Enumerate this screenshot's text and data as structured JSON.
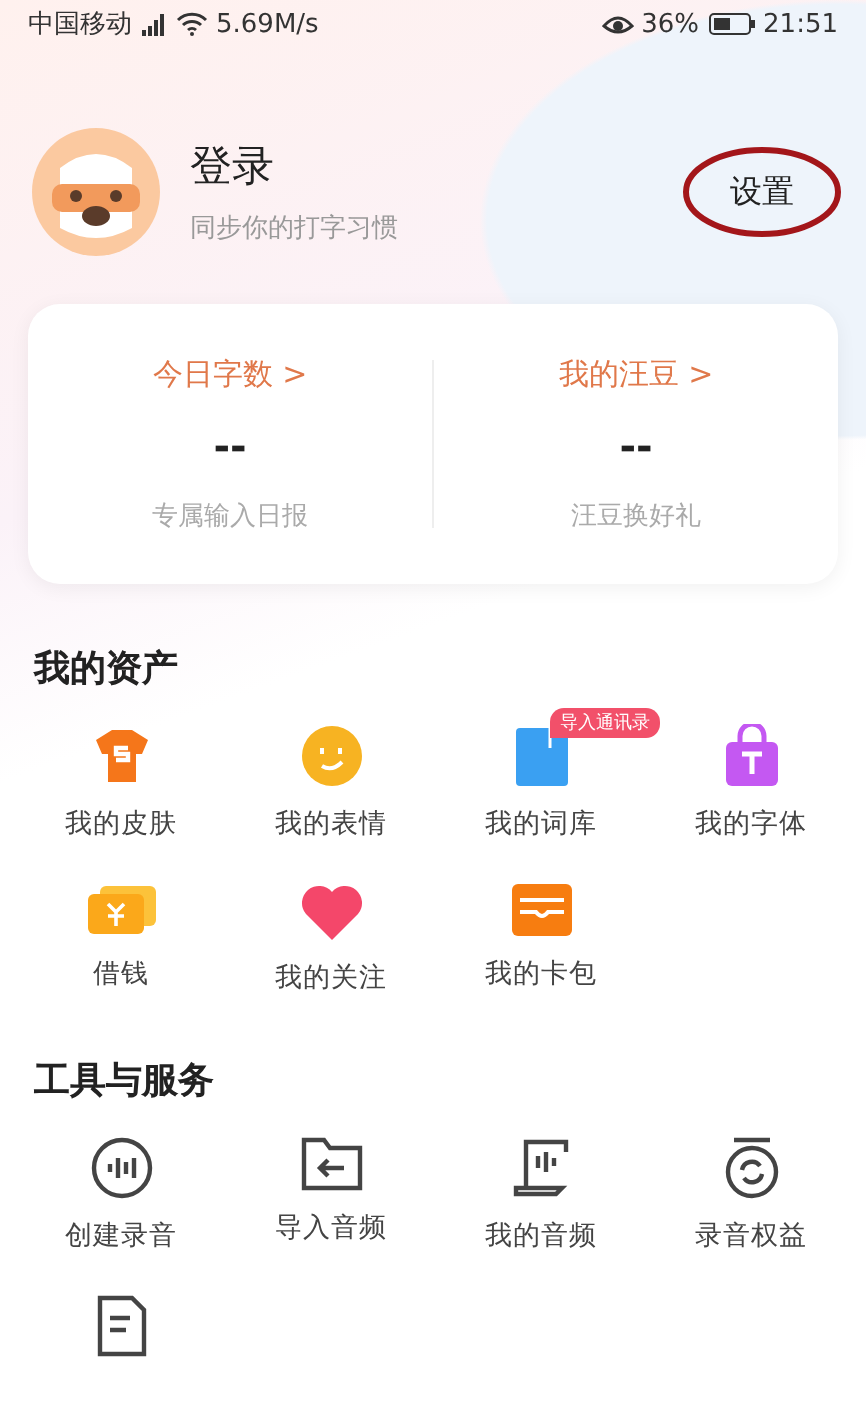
{
  "status_bar": {
    "carrier": "中国移动",
    "speed": "5.69M/s",
    "battery": "36%",
    "time": "21:51"
  },
  "profile": {
    "name": "登录",
    "subtitle": "同步你的打字习惯",
    "settings": "设置"
  },
  "stats": [
    {
      "title": "今日字数",
      "arrow": ">",
      "value": "--",
      "caption": "专属输入日报"
    },
    {
      "title": "我的汪豆",
      "arrow": ">",
      "value": "--",
      "caption": "汪豆换好礼"
    }
  ],
  "assets": {
    "title": "我的资产",
    "items": [
      {
        "label": "我的皮肤"
      },
      {
        "label": "我的表情"
      },
      {
        "label": "我的词库",
        "badge": "导入通讯录"
      },
      {
        "label": "我的字体"
      },
      {
        "label": "借钱"
      },
      {
        "label": "我的关注"
      },
      {
        "label": "我的卡包"
      }
    ]
  },
  "tools": {
    "title": "工具与服务",
    "items": [
      {
        "label": "创建录音"
      },
      {
        "label": "导入音频"
      },
      {
        "label": "我的音频"
      },
      {
        "label": "录音权益",
        "kind": "full"
      },
      {
        "kind": "partial"
      }
    ]
  }
}
